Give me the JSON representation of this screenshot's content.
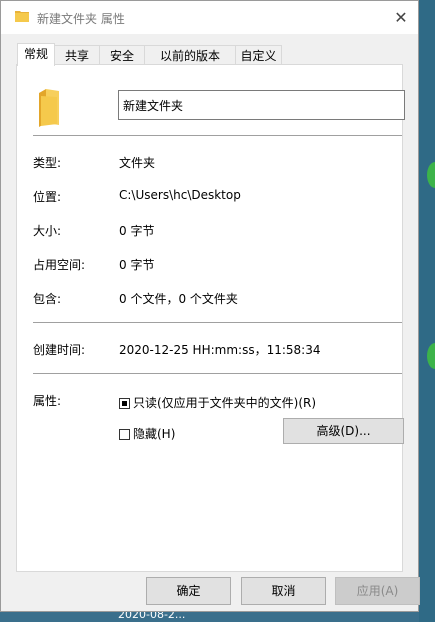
{
  "window": {
    "title": "新建文件夹 属性",
    "close_symbol": "✕"
  },
  "tabs": [
    {
      "label": "常规",
      "active": true
    },
    {
      "label": "共享",
      "active": false
    },
    {
      "label": "安全",
      "active": false
    },
    {
      "label": "以前的版本",
      "active": false
    },
    {
      "label": "自定义",
      "active": false
    }
  ],
  "general": {
    "folder_name": "新建文件夹",
    "type_label": "类型:",
    "type_value": "文件夹",
    "location_label": "位置:",
    "location_value": "C:\\Users\\hc\\Desktop",
    "size_label": "大小:",
    "size_value": "0 字节",
    "disk_size_label": "占用空间:",
    "disk_size_value": "0 字节",
    "contains_label": "包含:",
    "contains_value": "0 个文件，0 个文件夹",
    "created_label": "创建时间:",
    "created_value": "2020-12-25 HH:mm:ss，11:58:34",
    "attributes_label": "属性:",
    "readonly_label": "只读(仅应用于文件夹中的文件)(R)",
    "readonly_state": "indeterminate",
    "hidden_label": "隐藏(H)",
    "hidden_state": "unchecked",
    "advanced_button": "高级(D)..."
  },
  "footer": {
    "ok": "确定",
    "cancel": "取消",
    "apply": "应用(A)"
  },
  "desktop": {
    "bottom_text": "2020-08-2..."
  },
  "colors": {
    "dialog_bg": "#f0f0f0",
    "panel_bg": "#ffffff",
    "folder_yellow": "#f5c94c",
    "desktop_bg": "#3a6f8c"
  }
}
